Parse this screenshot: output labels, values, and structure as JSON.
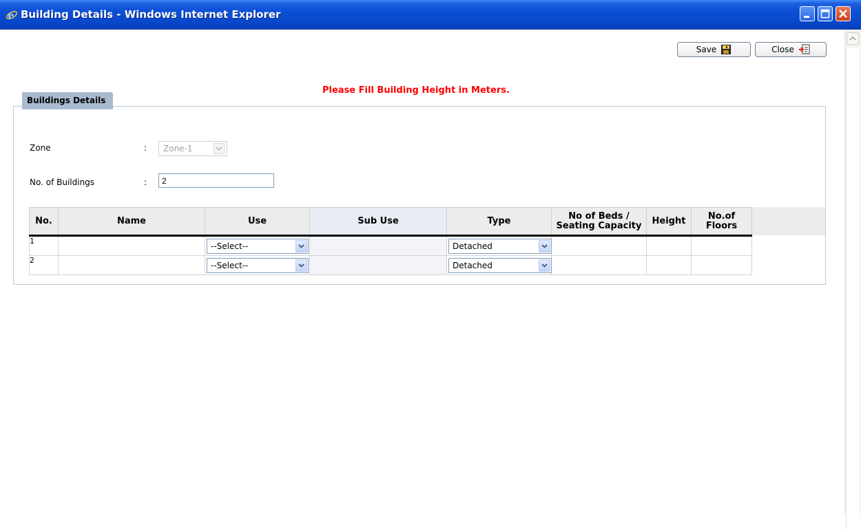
{
  "window": {
    "title": "Building Details - Windows Internet Explorer",
    "icon": "ie-icon"
  },
  "toolbar": {
    "save_label": "Save",
    "close_label": "Close"
  },
  "message": "Please Fill Building Height in Meters.",
  "panel": {
    "tab_label": "Buildings Details"
  },
  "form": {
    "zone_label": "Zone",
    "zone_colon": ":",
    "zone_value": "Zone-1",
    "buildings_label": "No. of Buildings",
    "buildings_colon": ":",
    "buildings_value": "2"
  },
  "grid": {
    "headers": {
      "no": "No.",
      "name": "Name",
      "use": "Use",
      "sub_use": "Sub Use",
      "type": "Type",
      "beds_line1": "No of Beds /",
      "beds_line2": "Seating Capacity",
      "height": "Height",
      "floors_line1": "No.of",
      "floors_line2": "Floors"
    },
    "rows": [
      {
        "no": "1",
        "use": "--Select--",
        "type": "Detached"
      },
      {
        "no": "2",
        "use": "--Select--",
        "type": "Detached"
      }
    ]
  },
  "colors": {
    "titlebar": "#0a4fd6",
    "message": "#ff0000",
    "tab": "#a9b9ce"
  }
}
